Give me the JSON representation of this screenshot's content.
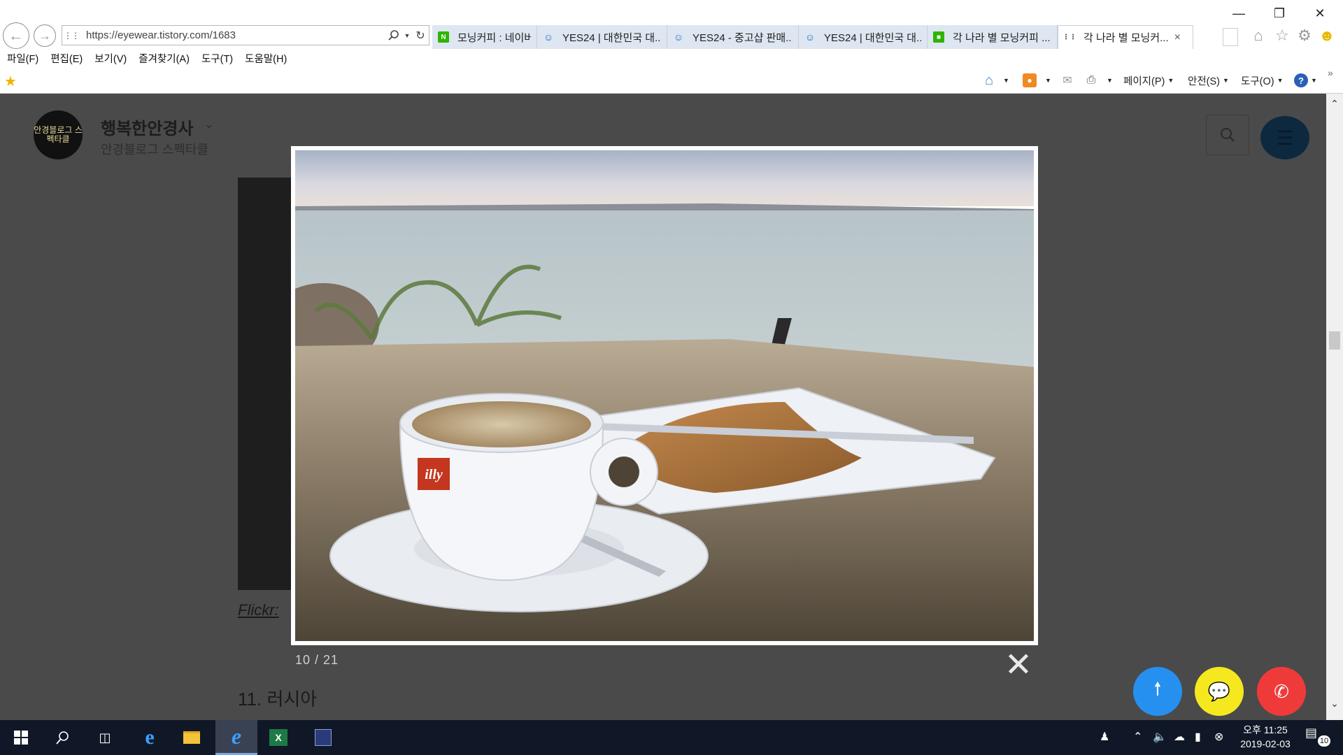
{
  "browser": {
    "url": "https://eyewear.tistory.com/1683",
    "tabs": [
      {
        "icon": "naver-icon",
        "label": "모닝커피 : 네이버 이...",
        "active": false
      },
      {
        "icon": "yes24-icon",
        "label": "YES24 | 대한민국 대...",
        "active": false
      },
      {
        "icon": "yes24-icon",
        "label": "YES24 - 중고샵 판매...",
        "active": false
      },
      {
        "icon": "yes24-icon",
        "label": "YES24 | 대한민국 대...",
        "active": false
      },
      {
        "icon": "chat-icon",
        "label": "각 나라 별 모닝커피 ...",
        "active": false
      },
      {
        "icon": "tistory-icon",
        "label": "각 나라 별 모닝커...",
        "active": true
      }
    ],
    "close_symbol": "×"
  },
  "menubar": {
    "items": [
      "파일(F)",
      "편집(E)",
      "보기(V)",
      "즐겨찾기(A)",
      "도구(T)",
      "도움말(H)"
    ]
  },
  "commandbar": {
    "page_label": "페이지(P)",
    "safety_label": "안전(S)",
    "tools_label": "도구(O)"
  },
  "blog": {
    "logo_text": "안경블로그 스펙타클",
    "title": "행복한안경사",
    "subtitle": "안경블로그 스펙타클",
    "caption_link": "Flickr: ",
    "section_heading": "11. 러시아"
  },
  "lightbox": {
    "counter": "10 / 21",
    "close_symbol": "✕",
    "cup_brand": "illy"
  },
  "taskbar": {
    "clock_period_time": "오후 11:25",
    "clock_date": "2019-02-03",
    "notification_count": "10"
  },
  "colors": {
    "fab_top": "#2690f0",
    "fab_chat": "#f6e81e",
    "fab_call": "#ef3a3a",
    "overlay": "#4a4a4a",
    "taskbar": "#101827"
  }
}
